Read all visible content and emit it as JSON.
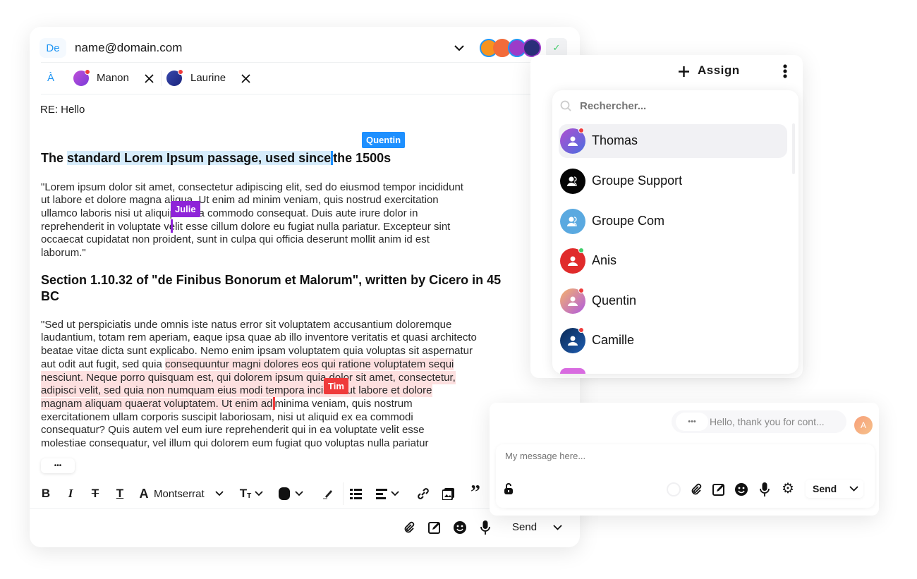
{
  "colors": {
    "accent": "#2196f3",
    "quentin": "#1e90ff",
    "julie": "#8e24d8",
    "tim": "#ef3b3b",
    "highlight_blue": "#d6ecfb",
    "highlight_red": "#fde0e0",
    "online": "#3ecf6a",
    "busy": "#ef3b3b"
  },
  "email": {
    "from_label": "De",
    "from_value": "name@domain.com",
    "to_label": "À",
    "recipients": [
      {
        "name": "Manon",
        "remove_icon": "close-icon"
      },
      {
        "name": "Laurine",
        "remove_icon": "close-icon"
      }
    ],
    "subject": "RE: Hello",
    "collaborators": [
      "Quentin",
      "Julie",
      "Tim"
    ],
    "heading1": {
      "before": "The ",
      "highlighted": "standard Lorem Ipsum passage, used since",
      "after": "the 1500s"
    },
    "para1": [
      "\"Lorem ipsum dolor sit amet, consectetur adipiscing elit, sed do eiusmod tempor incididunt",
      "ut labore et dolore magna aliqua. Ut enim ad minim veniam, quis nostrud exercitation",
      "ullamco laboris nisi ut aliquip ex ea commodo consequat. Duis aute irure dolor in",
      "reprehenderit in voluptate velit esse cillum dolore eu fugiat nulla pariatur. Excepteur sint",
      "occaecat cupidatat non proident, sunt in culpa qui officia deserunt mollit anim id est",
      "laborum.\""
    ],
    "heading2": [
      "Section 1.10.32 of \"de Finibus Bonorum et Malorum\", written by Cicero in 45",
      "BC"
    ],
    "para2": {
      "l1": "\"Sed ut perspiciatis unde omnis iste natus error sit voluptatem accusantium doloremque",
      "l2": "laudantium, totam rem aperiam, eaque ipsa quae ab illo inventore veritatis et quasi architecto",
      "l3": "beatae vitae dicta sunt explicabo. Nemo enim ipsam voluptatem quia voluptas sit aspernatur",
      "l4a": "aut odit aut fugit, sed quia ",
      "l4b": "consequuntur magni dolores eos qui ratione voluptatem sequi",
      "l5": "nesciunt. Neque porro quisquam est, qui dolorem ipsum quia dolor sit amet, consectetur,",
      "l6": "adipisci velit, sed quia non numquam eius modi tempora incidunt ut labore et dolore",
      "l7a": "magnam aliquam quaerat voluptatem. Ut enim ad",
      "l7b": "minima veniam, quis nostrum",
      "l8": "exercitationem ullam corporis suscipit laboriosam, nisi ut aliquid ex ea commodi",
      "l9": "consequatur? Quis autem vel eum iure reprehenderit qui in ea voluptate velit esse",
      "l10": "molestiae consequatur, vel illum qui dolorem eum fugiat quo voluptas nulla pariatur"
    },
    "more_label": "•••",
    "toolbar": {
      "font": "Montserrat",
      "icons": [
        "bold-icon",
        "italic-icon",
        "strikethrough-icon",
        "underline-icon",
        "font-icon",
        "text-size-icon",
        "color-icon",
        "highlighter-icon",
        "list-icon",
        "align-icon",
        "link-icon",
        "image-icon",
        "quote-icon"
      ]
    },
    "send_label": "Send"
  },
  "assign": {
    "label": "Assign",
    "search_placeholder": "Rechercher...",
    "items": [
      {
        "name": "Thomas",
        "status": "busy",
        "selected": true
      },
      {
        "name": "Groupe Support"
      },
      {
        "name": "Groupe Com"
      },
      {
        "name": "Anis",
        "status": "online"
      },
      {
        "name": "Quentin",
        "status": "busy"
      },
      {
        "name": "Camille",
        "status": "busy"
      }
    ]
  },
  "chat": {
    "typing": "•••",
    "message": "Hello, thank you for cont...",
    "avatar_initial": "A",
    "input_placeholder": "My message here...",
    "send_label": "Send"
  }
}
